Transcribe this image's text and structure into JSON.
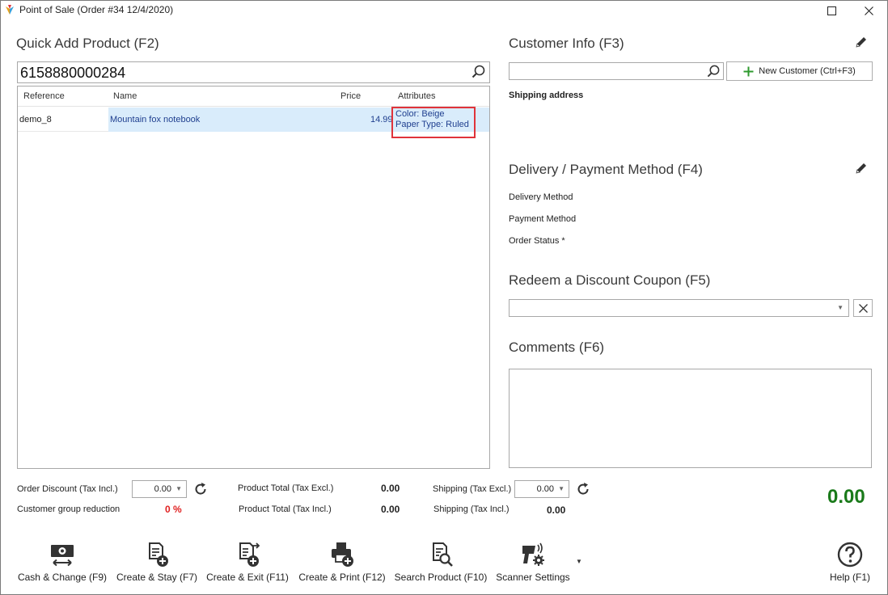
{
  "window": {
    "title": "Point of Sale (Order #34 12/4/2020)"
  },
  "quick_add": {
    "title": "Quick Add Product (F2)",
    "search_value": "6158880000284",
    "columns": [
      "Reference",
      "Name",
      "Price",
      "Attributes"
    ],
    "rows": [
      {
        "reference": "demo_8",
        "name": "Mountain fox notebook",
        "price": "14.99",
        "attr_color": "Color: Beige",
        "attr_paper": "Paper Type: Ruled"
      }
    ]
  },
  "customer": {
    "title": "Customer Info (F3)",
    "search_value": "",
    "new_button": "New Customer (Ctrl+F3)",
    "shipping_label": "Shipping address"
  },
  "delivery": {
    "title": "Delivery / Payment Method (F4)",
    "delivery_label": "Delivery Method",
    "payment_label": "Payment Method",
    "status_label": "Order Status *"
  },
  "coupon": {
    "title": "Redeem a Discount Coupon (F5)",
    "value": ""
  },
  "comments": {
    "title": "Comments (F6)",
    "value": ""
  },
  "totals": {
    "order_discount_label": "Order Discount (Tax Incl.)",
    "order_discount_value": "0.00",
    "group_reduction_label": "Customer group reduction",
    "group_reduction_value": "0 %",
    "product_total_excl_label": "Product Total (Tax Excl.)",
    "product_total_excl_value": "0.00",
    "product_total_incl_label": "Product Total (Tax Incl.)",
    "product_total_incl_value": "0.00",
    "shipping_excl_label": "Shipping (Tax Excl.)",
    "shipping_excl_value": "0.00",
    "shipping_incl_label": "Shipping (Tax Incl.)",
    "shipping_incl_value": "0.00",
    "grand_total": "0.00"
  },
  "toolbar": {
    "cash": "Cash & Change (F9)",
    "create_stay": "Create & Stay (F7)",
    "create_exit": "Create & Exit (F11)",
    "create_print": "Create & Print (F12)",
    "search_product": "Search Product (F10)",
    "scanner": "Scanner Settings",
    "help": "Help (F1)"
  },
  "colors": {
    "accent_green": "#1a7a1a",
    "reduction_red": "#e02020",
    "highlight_border": "#e0333a",
    "selection": "#d9ecfb"
  }
}
